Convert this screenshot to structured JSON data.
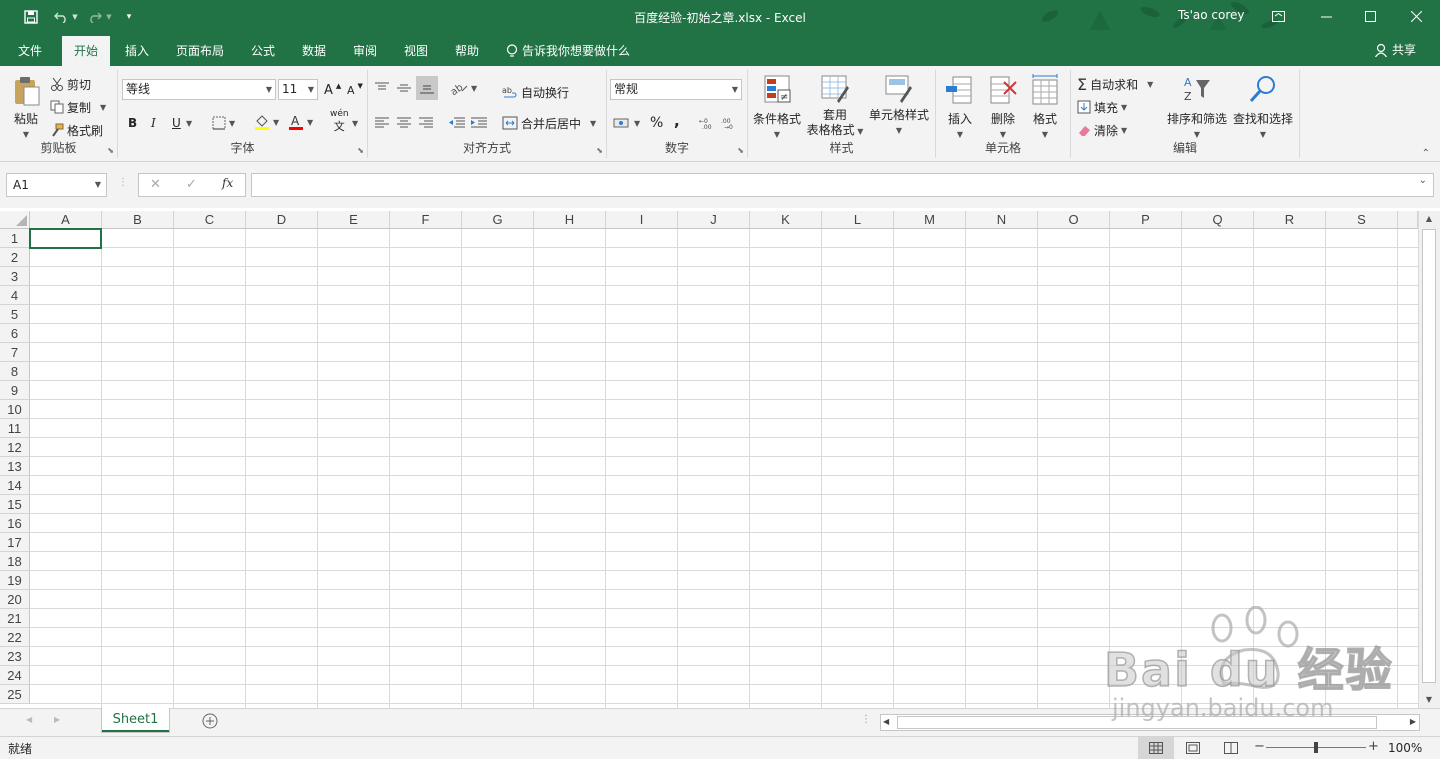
{
  "titlebar": {
    "doc_title": "百度经验-初始之章.xlsx  -  Excel",
    "user": "Ts'ao corey"
  },
  "tabs": [
    "文件",
    "开始",
    "插入",
    "页面布局",
    "公式",
    "数据",
    "审阅",
    "视图",
    "帮助"
  ],
  "tell_me": "告诉我你想要做什么",
  "share": "共享",
  "ribbon": {
    "clipboard": {
      "paste": "粘贴",
      "cut": "剪切",
      "copy": "复制",
      "format_painter": "格式刷",
      "label": "剪贴板"
    },
    "font": {
      "name": "等线",
      "size": "11",
      "bold": "B",
      "italic": "I",
      "underline": "U",
      "grow": "A",
      "shrink": "A",
      "phonetic": "wén",
      "label": "字体"
    },
    "alignment": {
      "wrap": "自动换行",
      "merge": "合并后居中",
      "label": "对齐方式"
    },
    "number": {
      "format": "常规",
      "percent": "%",
      "comma": ",",
      "label": "数字"
    },
    "styles": {
      "conditional": "条件格式",
      "table_1": "套用",
      "table_2": "表格格式",
      "cell_styles": "单元格样式",
      "label": "样式"
    },
    "cells": {
      "insert": "插入",
      "delete": "删除",
      "format": "格式",
      "label": "单元格"
    },
    "editing": {
      "autosum": "自动求和",
      "fill": "填充",
      "clear": "清除",
      "sort": "排序和筛选",
      "find": "查找和选择",
      "label": "编辑"
    }
  },
  "formula_bar": {
    "name_box": "A1",
    "fx": "fx",
    "cancel": "✕",
    "enter": "✓",
    "value": ""
  },
  "columns": [
    "A",
    "B",
    "C",
    "D",
    "E",
    "F",
    "G",
    "H",
    "I",
    "J",
    "K",
    "L",
    "M",
    "N",
    "O",
    "P",
    "Q",
    "R",
    "S"
  ],
  "rows": [
    "1",
    "2",
    "3",
    "4",
    "5",
    "6",
    "7",
    "8",
    "9",
    "10",
    "11",
    "12",
    "13",
    "14",
    "15",
    "16",
    "17",
    "18",
    "19",
    "20",
    "21",
    "22",
    "23",
    "24",
    "25"
  ],
  "sheet_tabs": [
    "Sheet1"
  ],
  "status": {
    "ready": "就绪",
    "zoom": "100%",
    "zoom_level": 1.0
  },
  "watermark": {
    "brand": "Bai du 经验",
    "url": "jingyan.baidu.com"
  },
  "colors": {
    "accent": "#217346",
    "ribbon_bg": "#f3f3f3"
  }
}
